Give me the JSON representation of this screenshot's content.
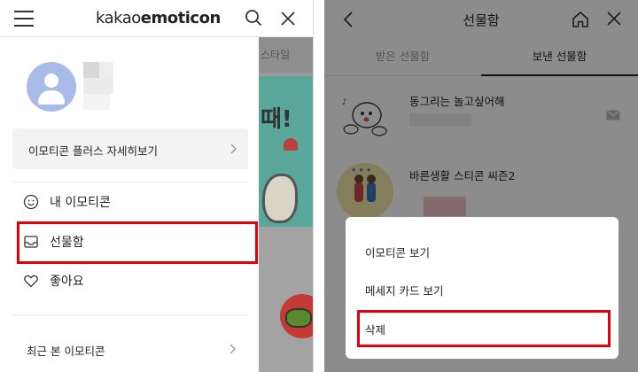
{
  "left_panel": {
    "header": {
      "logo_light": "kakao",
      "logo_bold": "emoticon"
    },
    "background_page": {
      "tab_label": "스타일",
      "banner_text": "때!"
    },
    "plus_card": {
      "label": "이모티콘 플러스 자세히보기"
    },
    "menu_items": [
      {
        "label": "내 이모티콘",
        "icon": "smiley-icon"
      },
      {
        "label": "선물함",
        "icon": "inbox-icon",
        "highlighted": true
      },
      {
        "label": "좋아요",
        "icon": "heart-icon"
      }
    ],
    "recent": {
      "label": "최근 본 이모티콘"
    },
    "colors": {
      "highlight": "#e3000b",
      "avatar": "#a9bbe8"
    }
  },
  "right_panel": {
    "title": "선물함",
    "tabs": [
      {
        "label": "받은 선물함",
        "active": false
      },
      {
        "label": "보낸 선물함",
        "active": true
      }
    ],
    "gifts": [
      {
        "name": "동그리는 놀고싶어해"
      },
      {
        "name": "바른생활 스티콘 씨즌2"
      }
    ],
    "action_sheet": {
      "options": [
        {
          "label": "이모티콘 보기"
        },
        {
          "label": "메세지 카드 보기"
        },
        {
          "label": "삭제",
          "highlighted": true
        }
      ]
    }
  }
}
